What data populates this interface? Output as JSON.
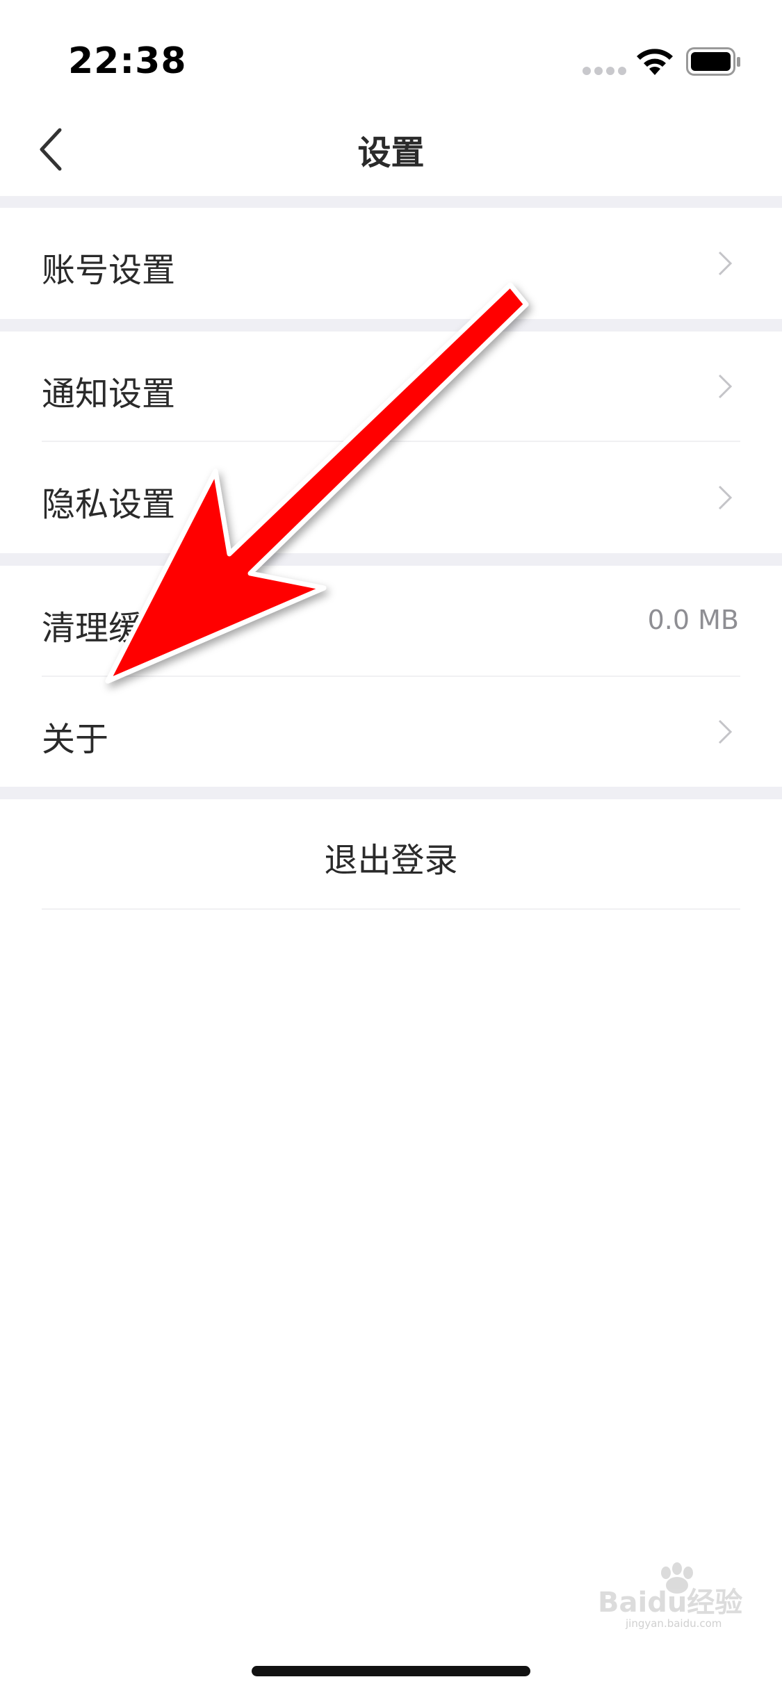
{
  "status_bar": {
    "time": "22:38",
    "icons": [
      "signal-dots-icon",
      "wifi-icon",
      "battery-icon"
    ]
  },
  "nav": {
    "title": "设置",
    "back_icon": "chevron-left-icon"
  },
  "settings": {
    "account": {
      "label": "账号设置"
    },
    "notification": {
      "label": "通知设置"
    },
    "privacy": {
      "label": "隐私设置"
    },
    "cache": {
      "label": "清理缓存",
      "value": "0.0 MB"
    },
    "about": {
      "label": "关于"
    }
  },
  "logout": {
    "label": "退出登录"
  },
  "annotation": {
    "type": "red-arrow",
    "color": "#ff0000",
    "points_to": "about"
  },
  "watermark": {
    "text": "Baidu经验",
    "subtext": "jingyan.baidu.com"
  },
  "colors": {
    "background": "#ffffff",
    "group_gap": "#efeff4",
    "text": "#2a2a2a",
    "secondary_text": "#8e8e93",
    "arrow": "#ff0000"
  }
}
